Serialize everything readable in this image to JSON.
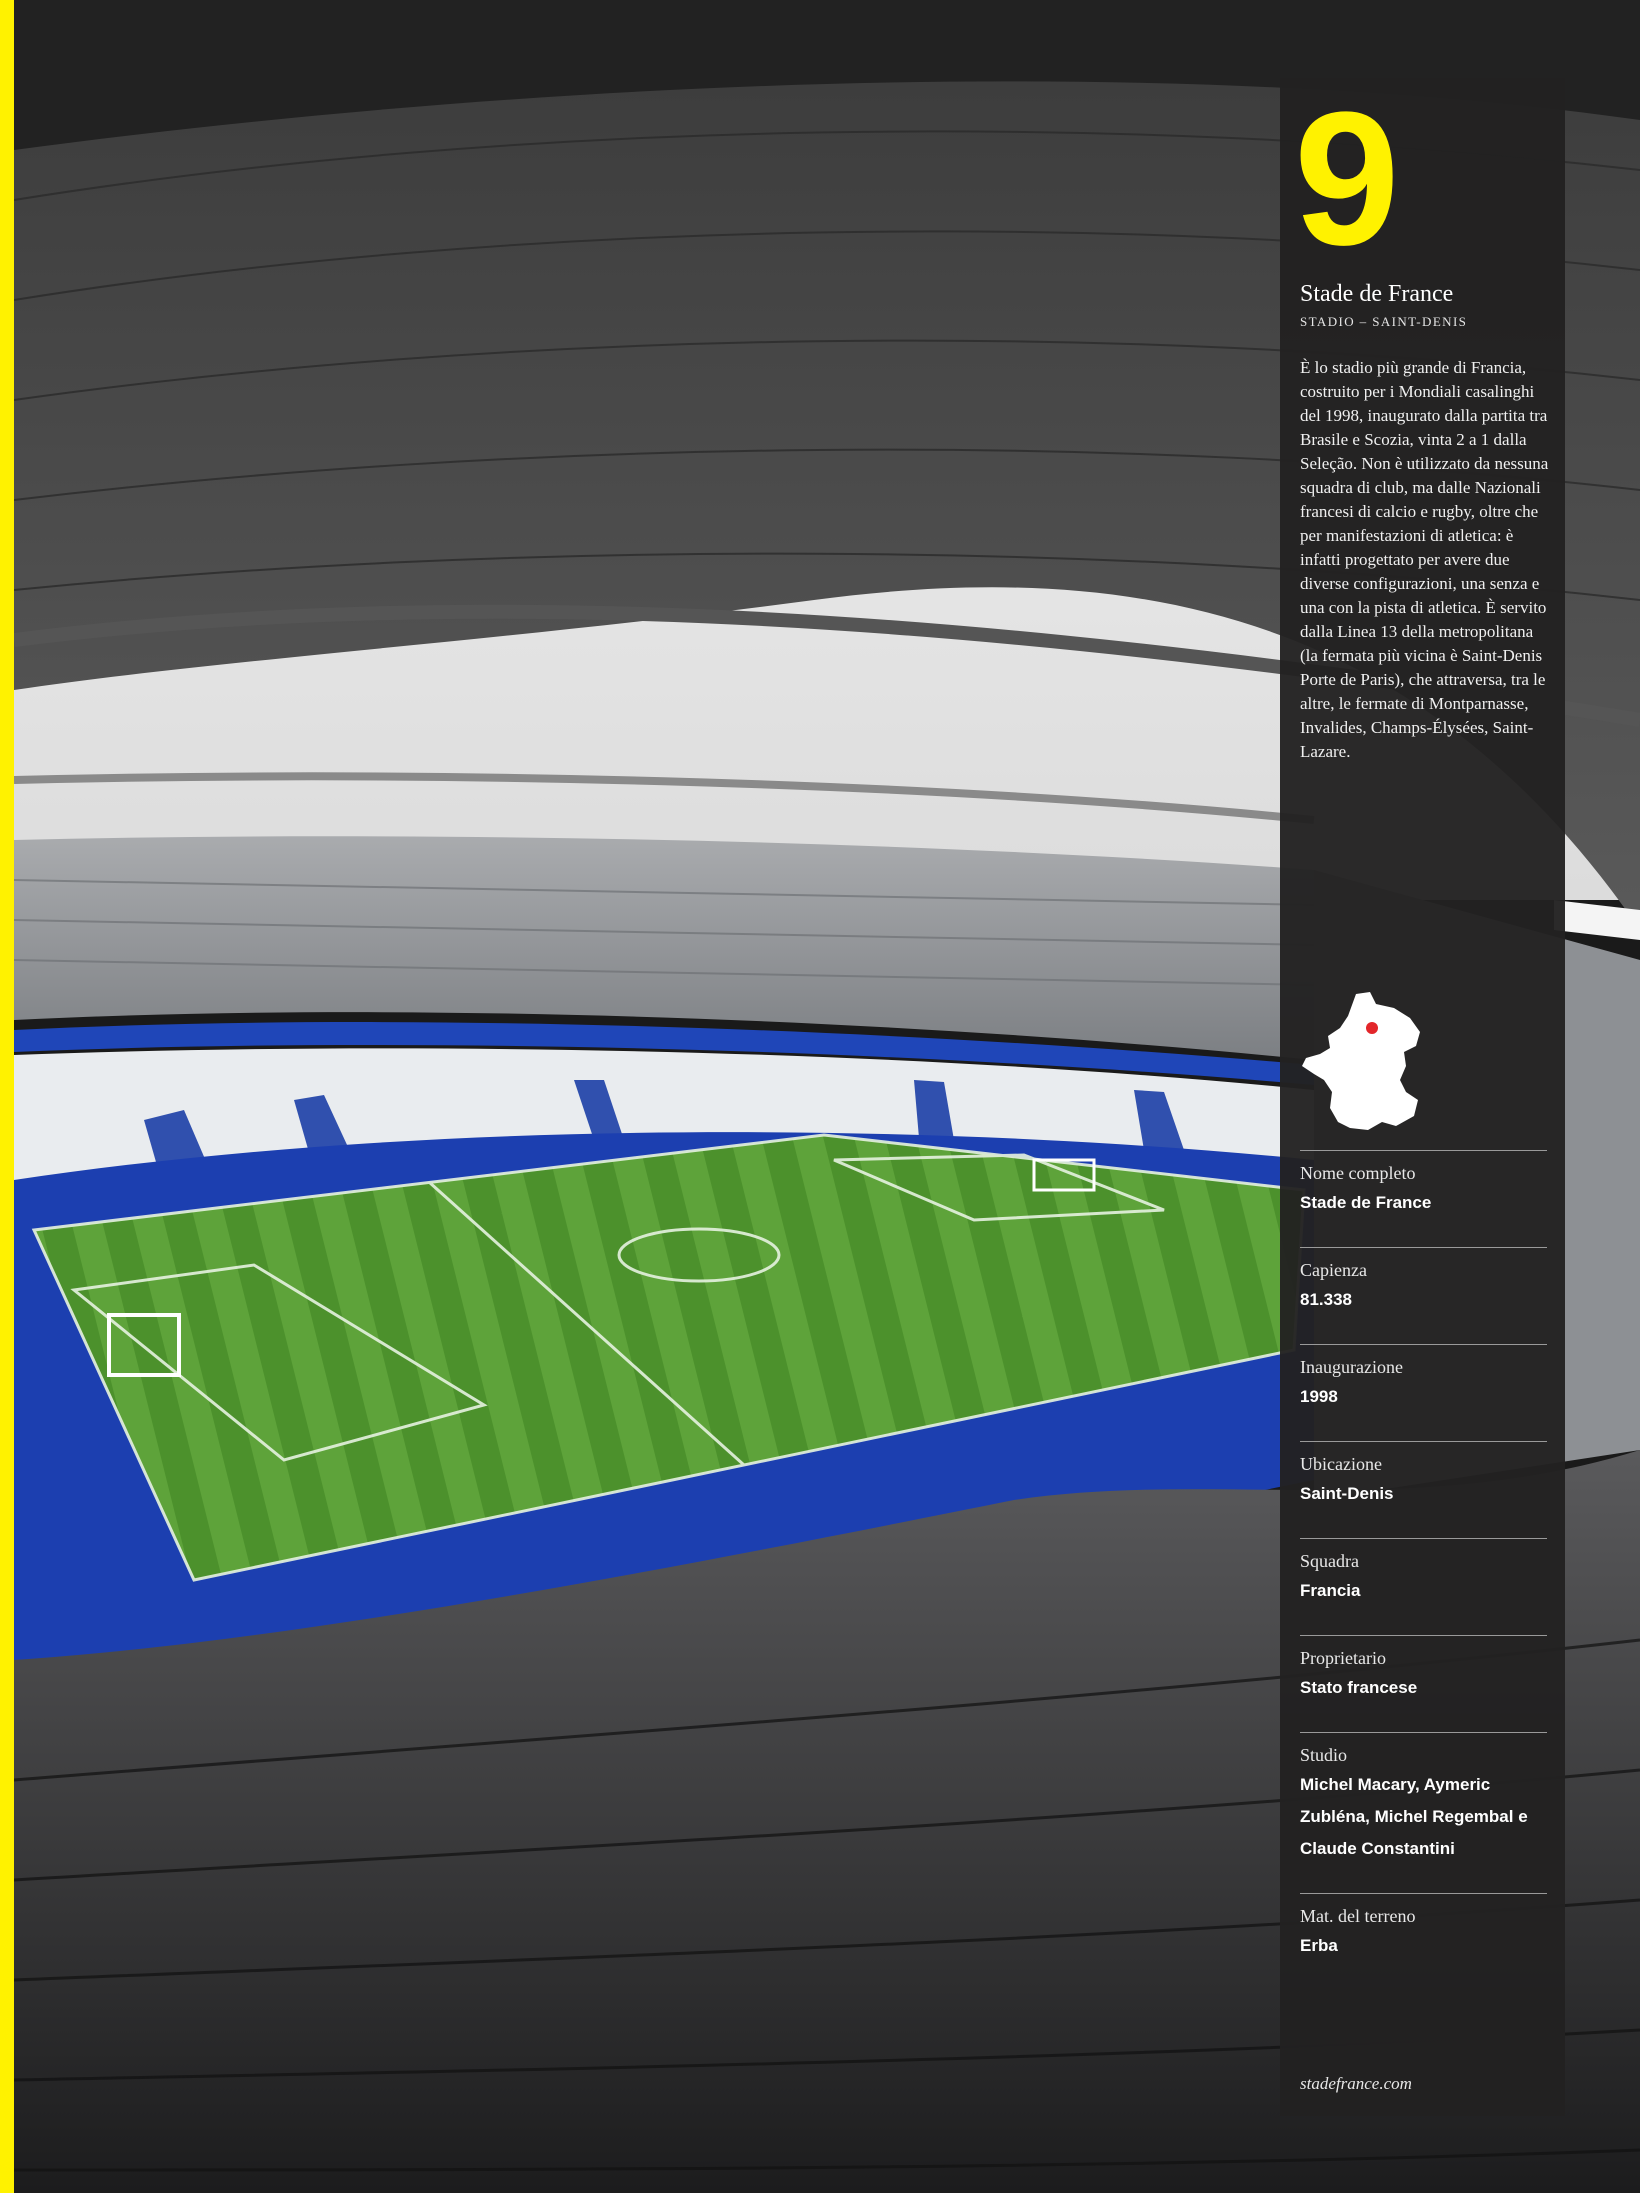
{
  "stadium": {
    "number": "9",
    "name": "Stade de France",
    "subtitle": "STADIO – SAINT-DENIS",
    "description": "È lo stadio più grande di Francia, costruito per i Mondiali casalinghi del 1998, inaugurato dalla partita tra Brasile e Scozia, vinta 2 a 1 dalla Seleção. Non è utilizzato da nessuna squadra di club, ma dalle Nazionali francesi di calcio e rugby, oltre che per manifestazioni di atletica: è infatti progettato per avere due diverse configurazioni, una senza e una con la pista di atletica. È servito dalla Linea 13 della metropolitana (la fermata più vicina è Saint-Denis Porte de Paris), che attraversa, tra le altre, le fermate di Montparnasse, Invalides, Champs-Élysées, Saint-Lazare."
  },
  "facts": [
    {
      "label": "Nome completo",
      "value": "Stade de France"
    },
    {
      "label": "Capienza",
      "value": "81.338"
    },
    {
      "label": "Inaugurazione",
      "value": "1998"
    },
    {
      "label": "Ubicazione",
      "value": "Saint-Denis"
    },
    {
      "label": "Squadra",
      "value": "Francia"
    },
    {
      "label": "Proprietario",
      "value": "Stato francese"
    },
    {
      "label": "Studio",
      "value": "Michel Macary, Aymeric Zubléna, Michel Regembal e Claude Constantini"
    },
    {
      "label": "Mat. del terreno",
      "value": "Erba"
    }
  ],
  "website": "stadefrance.com",
  "colors": {
    "accent": "#fff200",
    "panel": "#222121",
    "map_dot": "#e3262a"
  }
}
